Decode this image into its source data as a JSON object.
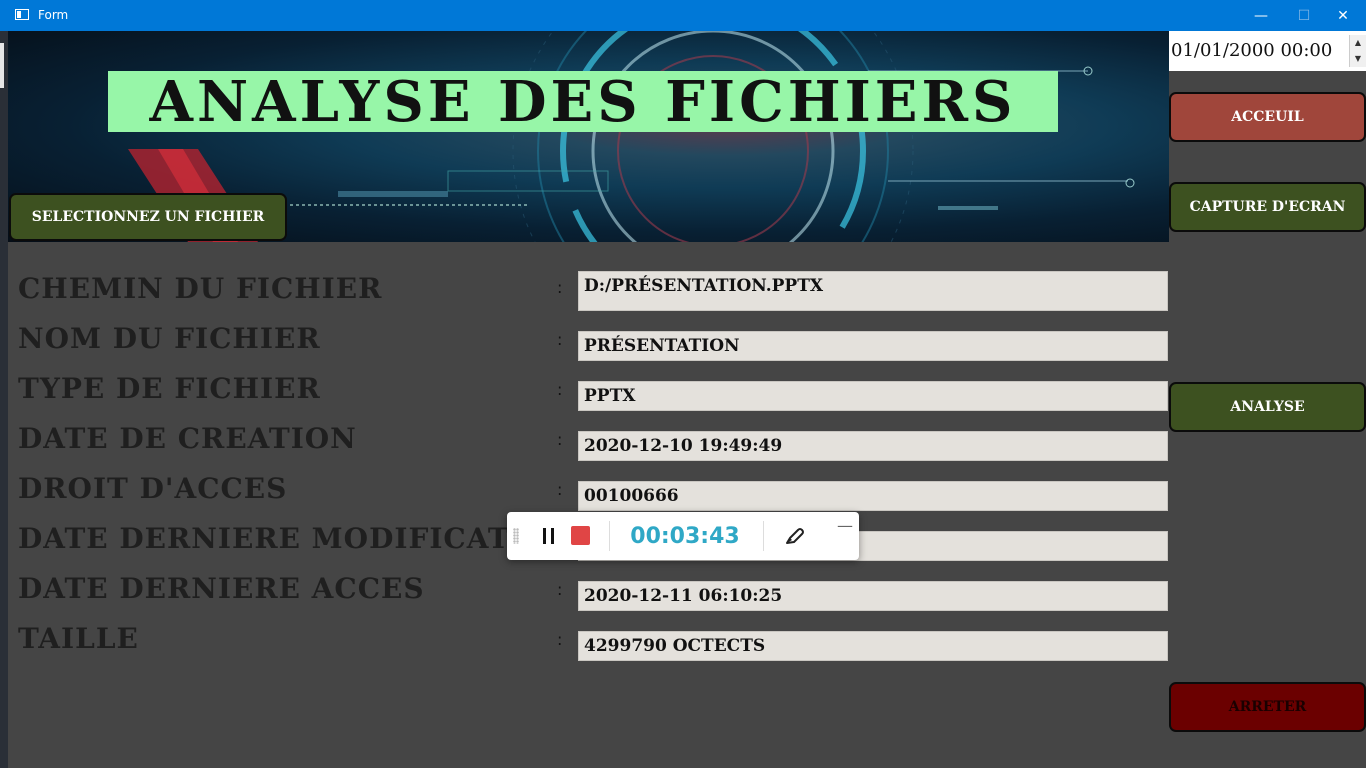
{
  "window": {
    "title": "Form",
    "minimize": "—",
    "maximize": "☐",
    "close": "✕"
  },
  "banner": {
    "title": "ANALYSE DES  FICHIERS"
  },
  "datetime": {
    "value": "01/01/2000 00:00",
    "up": "▲",
    "down": "▼"
  },
  "buttons": {
    "select_file": "SELECTIONNEZ UN FICHIER",
    "acceuil": "ACCEUIL",
    "capture": "CAPTURE D'ECRAN",
    "analyse": "ANALYSE",
    "arreter": "ARRETER"
  },
  "fields": [
    {
      "label": "CHEMIN DU FICHIER",
      "value": "D:/PRÉSENTATION.PPTX"
    },
    {
      "label": "NOM DU FICHIER",
      "value": "PRÉSENTATION"
    },
    {
      "label": "TYPE DE FICHIER",
      "value": "PPTX"
    },
    {
      "label": "DATE DE CREATION",
      "value": "2020-12-10 19:49:49"
    },
    {
      "label": "DROIT D'ACCES",
      "value": "00100666"
    },
    {
      "label": "DATE DERNIERE MODIFICATION",
      "value": ""
    },
    {
      "label": "DATE DERNIERE ACCES",
      "value": "2020-12-11 06:10:25"
    },
    {
      "label": "TAILLE",
      "value": "4299790 OCTECTS"
    }
  ],
  "colon": ":",
  "recorder": {
    "timer": "00:03:43"
  },
  "colors": {
    "titlebar": "#0078d7",
    "background": "#454545",
    "banner_title_bg": "#97f6a8",
    "green_button": "#3d5120",
    "red_button": "#a0463b",
    "stop_button": "#6b0000",
    "field_bg": "#e4e1dc",
    "timer": "#2fa8c6"
  }
}
